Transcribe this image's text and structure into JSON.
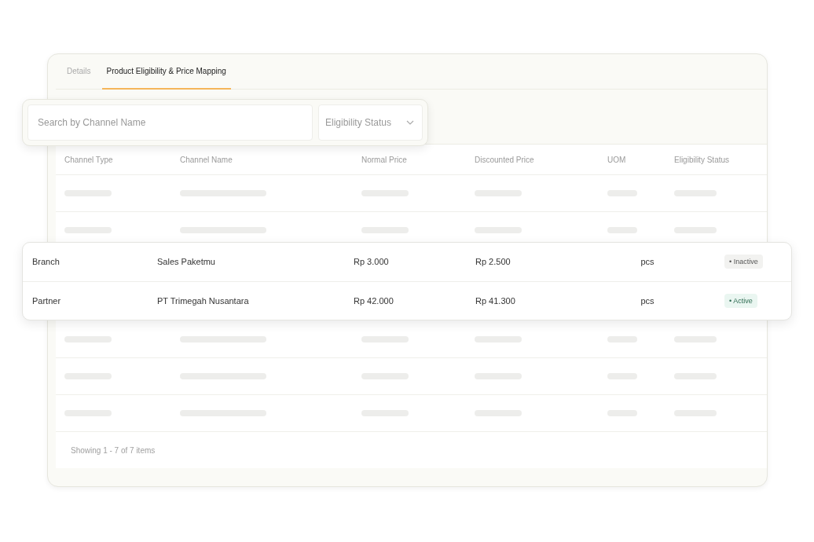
{
  "tabs": [
    {
      "label": "Details",
      "selected": false
    },
    {
      "label": "Product Eligibility & Price Mapping",
      "selected": true
    }
  ],
  "search": {
    "placeholder": "Search by Channel Name"
  },
  "status_filter": {
    "placeholder": "Eligibility Status"
  },
  "table": {
    "columns": [
      "Channel Type",
      "Channel Name",
      "Normal Price",
      "Discounted Price",
      "UOM",
      "Eligibility Status"
    ],
    "rows": [
      {
        "channel_type": "Branch",
        "channel_name": "Sales Paketmu",
        "normal_price": "Rp 3.000",
        "discounted_price": "Rp 2.500",
        "uom": "pcs",
        "status": {
          "label": "• Inactive",
          "kind": "inactive"
        }
      },
      {
        "channel_type": "Partner",
        "channel_name": "PT Trimegah Nusantara",
        "normal_price": "Rp 42.000",
        "discounted_price": "Rp 41.300",
        "uom": "pcs",
        "status": {
          "label": "• Active",
          "kind": "active"
        }
      }
    ],
    "footer": "Showing 1 - 7 of 7 items"
  }
}
